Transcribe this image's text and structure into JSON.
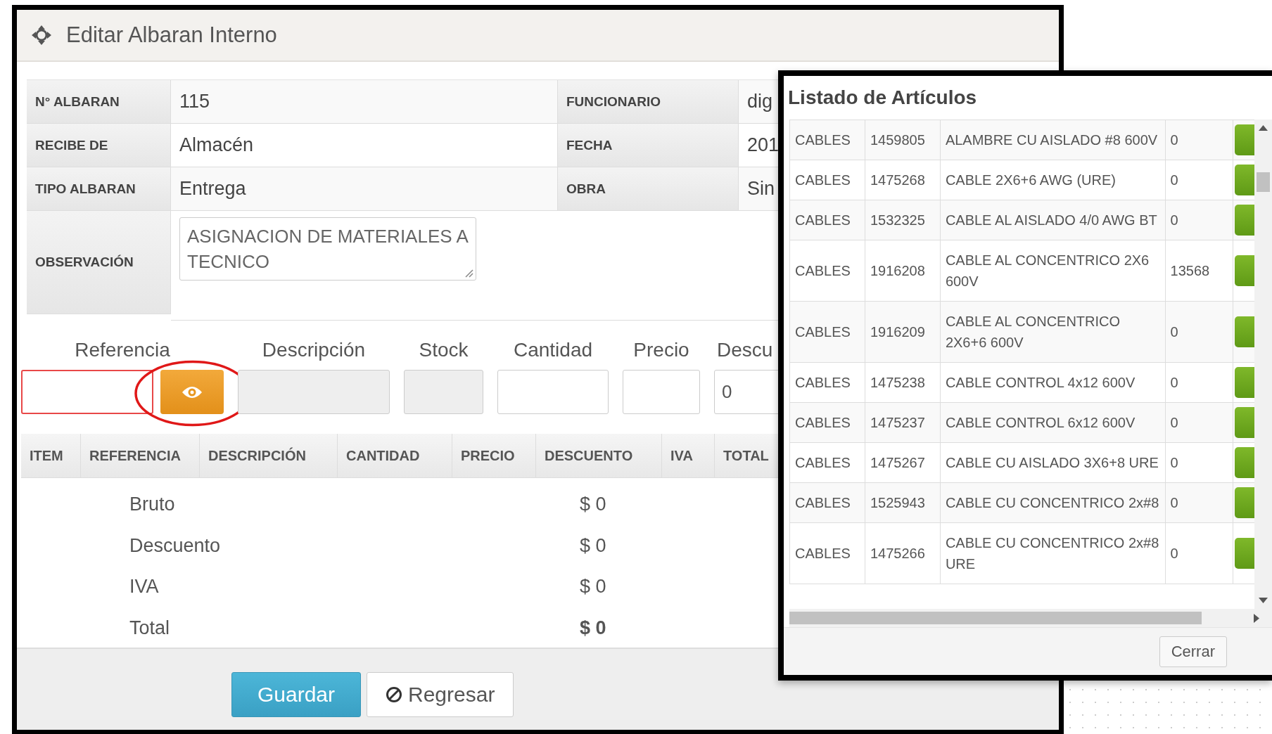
{
  "page": {
    "title": "Editar Albaran Interno"
  },
  "info": {
    "rows": [
      {
        "label": "N° ALBARAN",
        "value": "115",
        "label_2": "FUNCIONARIO",
        "value_2": "dig"
      },
      {
        "label": "RECIBE DE",
        "value": "Almacén",
        "label_2": "FECHA",
        "value_2": "201"
      },
      {
        "label": "TIPO ALBARAN",
        "value": "Entrega",
        "label_2": "OBRA",
        "value_2": "Sin"
      }
    ],
    "observation": {
      "label": "OBSERVACIÓN",
      "value": "ASIGNACION DE MATERIALES A TECNICO"
    }
  },
  "form": {
    "fields": [
      {
        "label": "Referencia",
        "kind": "required"
      },
      {
        "label": "Descripción",
        "kind": "readonly"
      },
      {
        "label": "Stock",
        "kind": "readonly"
      },
      {
        "label": "Cantidad",
        "kind": "input"
      },
      {
        "label": "Precio",
        "kind": "input"
      },
      {
        "label": "Descu",
        "kind": "input",
        "value": "0"
      }
    ],
    "lookup_button": {
      "highlighted": true
    }
  },
  "items_table": {
    "columns": [
      "ITEM",
      "REFERENCIA",
      "DESCRIPCIÓN",
      "CANTIDAD",
      "PRECIO",
      "DESCUENTO",
      "IVA",
      "TOTAL"
    ]
  },
  "totals": [
    {
      "label": "Bruto",
      "value": "$ 0",
      "bold": false
    },
    {
      "label": "Descuento",
      "value": "$ 0",
      "bold": false
    },
    {
      "label": "IVA",
      "value": "$ 0",
      "bold": false
    },
    {
      "label": "Total",
      "value": "$ 0",
      "bold": true
    }
  ],
  "buttons": [
    {
      "label": "Guardar",
      "kind": "primary"
    },
    {
      "label": "Regresar",
      "kind": "default"
    }
  ],
  "modal": {
    "title": "Listado de Artículos",
    "rows": [
      {
        "category": "CABLES",
        "code": "1459805",
        "description": "ALAMBRE CU AISLADO #8 600V",
        "stock": "0"
      },
      {
        "category": "CABLES",
        "code": "1475268",
        "description": "CABLE 2X6+6 AWG (URE)",
        "stock": "0"
      },
      {
        "category": "CABLES",
        "code": "1532325",
        "description": "CABLE AL AISLADO 4/0 AWG BT",
        "stock": "0"
      },
      {
        "category": "CABLES",
        "code": "1916208",
        "description": "CABLE AL CONCENTRICO 2X6 600V",
        "stock": "13568"
      },
      {
        "category": "CABLES",
        "code": "1916209",
        "description": "CABLE AL CONCENTRICO 2X6+6 600V",
        "stock": "0"
      },
      {
        "category": "CABLES",
        "code": "1475238",
        "description": "CABLE CONTROL 4x12 600V",
        "stock": "0"
      },
      {
        "category": "CABLES",
        "code": "1475237",
        "description": "CABLE CONTROL 6x12 600V",
        "stock": "0"
      },
      {
        "category": "CABLES",
        "code": "1475267",
        "description": "CABLE CU AISLADO 3X6+8 URE",
        "stock": "0"
      },
      {
        "category": "CABLES",
        "code": "1525943",
        "description": "CABLE CU CONCENTRICO 2x#8",
        "stock": "0"
      },
      {
        "category": "CABLES",
        "code": "1475266",
        "description": "CABLE CU CONCENTRICO 2x#8 URE",
        "stock": "0"
      }
    ],
    "close_button": "Cerrar"
  }
}
